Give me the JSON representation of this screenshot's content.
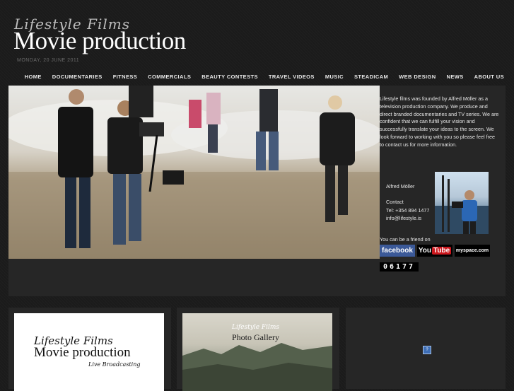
{
  "header": {
    "script_title": "Lifestyle Films",
    "main_title": "Movie production",
    "date": "MONDAY, 20 JUNE 2011"
  },
  "nav": {
    "items": [
      "HOME",
      "DOCUMENTARIES",
      "FITNESS",
      "COMMERCIALS",
      "BEAUTY CONTESTS",
      "TRAVEL VIDEOS",
      "MUSIC",
      "STEADICAM",
      "WEB DESIGN",
      "NEWS",
      "ABOUT US"
    ]
  },
  "feature": {
    "intro": "Lifestyle films was founded by Alfred Möller as a television production company. We produce and direct branded documentaries and TV series. We are confident that we can fulfill your vision and successfully translate your ideas to the screen. We look forward to working with you so please feel free to contact us for more information.",
    "contact_name": "Alfred Möller",
    "contact_label": "Contact",
    "contact_tel": "Tel: +354 894 1477",
    "contact_email": "info@lifestyle.is",
    "friend_text": "You can be a friend on",
    "social": {
      "facebook": "facebook",
      "youtube_you": "You",
      "youtube_tube": "Tube",
      "myspace": "myspace.com"
    },
    "counter": "06177"
  },
  "panels": {
    "p1": {
      "script": "Lifestyle Films",
      "main": "Movie production",
      "sub": "Live Broadcasting"
    },
    "p2": {
      "script": "Lifestyle Films",
      "title": "Photo Gallery"
    }
  },
  "colors": {
    "background": "#1b1b1b",
    "panel": "#262626",
    "facebook": "#3b5998",
    "youtube_red": "#cc181e"
  }
}
